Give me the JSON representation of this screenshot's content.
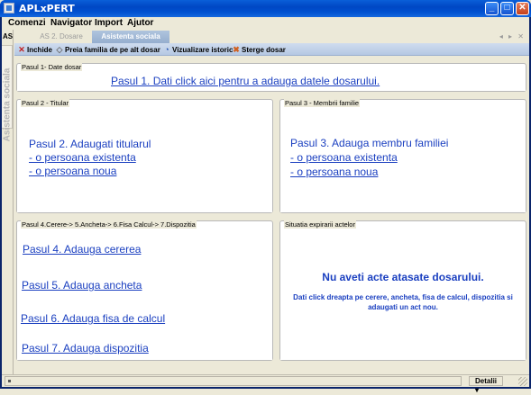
{
  "window": {
    "title": "APLxPERT",
    "btn_min": "_",
    "btn_max": "□",
    "btn_close": "✕"
  },
  "menu": {
    "items": [
      "Comenzi",
      "Navigator",
      "Import",
      "Ajutor"
    ]
  },
  "sidebar": {
    "label_as": "AS",
    "vertical_label": "Asistenta sociala"
  },
  "tabs": {
    "items": [
      "AS 2. Dosare",
      "Asistenta sociala"
    ],
    "active": "Asistenta sociala",
    "arrows": "◂ ▸ ✕"
  },
  "toolbar": {
    "inchide": "Inchide",
    "preia": "Preia familia de pe alt dosar",
    "istoric": "Vizualizare istoric",
    "sterge": "Sterge dosar"
  },
  "panels": {
    "p1": {
      "title": "Pasul 1- Date dosar",
      "link": "Pasul 1. Dati click aici pentru a adauga  datele dosarului."
    },
    "p2": {
      "title": "Pasul 2 - Titular",
      "heading": "Pasul 2. Adaugati titularul",
      "link_existing": "- o persoana existenta",
      "link_new": "- o persoana noua"
    },
    "p3": {
      "title": "Pasul 3 - Membrii familie",
      "heading": "Pasul 3. Adauga membru familiei",
      "link_existing": "- o persoana existenta",
      "link_new": "- o persoana noua"
    },
    "p4": {
      "title": "Pasul 4.Cerere-> 5.Ancheta-> 6.Fisa Calcul-> 7.Dispozitia",
      "link4": "Pasul 4. Adauga cererea ",
      "link5": "Pasul 5. Adauga ancheta ",
      "link6": "Pasul 6. Adauga fisa de calcul",
      "link7": "Pasul 7. Adauga dispozitia"
    },
    "p5": {
      "title": "Situatia expirarii actelor",
      "message": "Nu aveti acte atasate dosarului.",
      "hint": "Dati click dreapta pe cerere, ancheta, fisa de calcul, dispozitia si adaugati un act nou."
    }
  },
  "statusbar": {
    "detalii": "Detalii ▾"
  },
  "colors": {
    "link": "#1A3FC0",
    "titlebar": "#0050D0",
    "toolbar": "#C3D3EA"
  }
}
